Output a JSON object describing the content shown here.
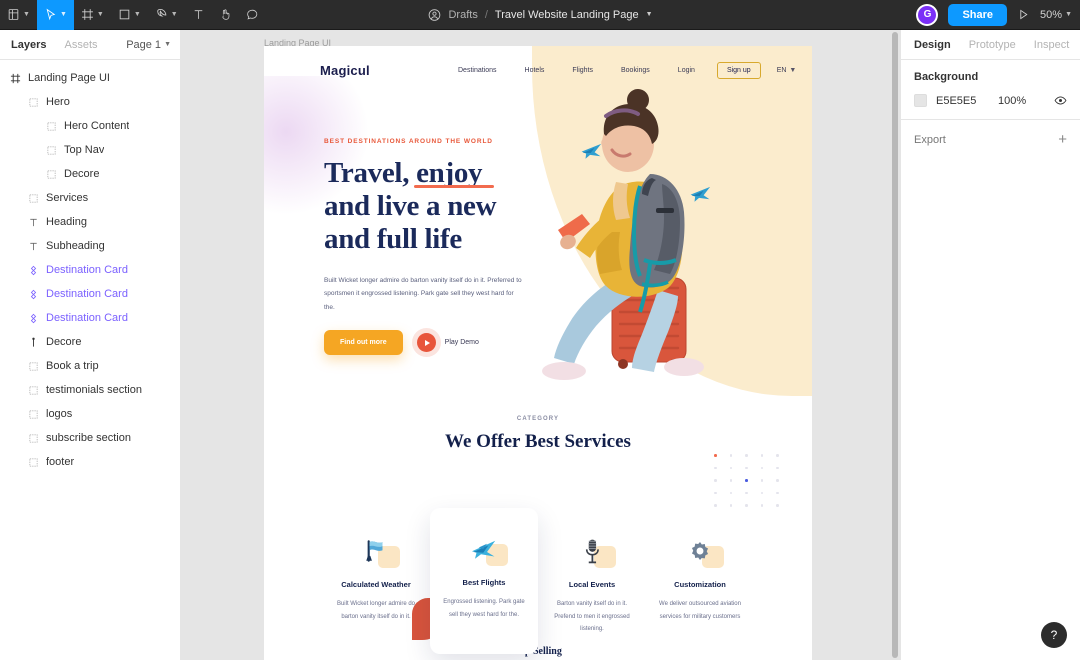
{
  "toolbar": {
    "tools": [
      {
        "name": "figma-menu-icon",
        "caret": true
      },
      {
        "name": "move-tool-icon",
        "caret": true,
        "active": true
      },
      {
        "name": "frame-tool-icon",
        "caret": true
      },
      {
        "name": "shape-tool-icon",
        "caret": true
      },
      {
        "name": "pen-tool-icon",
        "caret": true
      },
      {
        "name": "text-tool-icon",
        "caret": false
      },
      {
        "name": "hand-tool-icon",
        "caret": false
      },
      {
        "name": "comment-tool-icon",
        "caret": false
      }
    ],
    "breadcrumb_parent": "Drafts",
    "breadcrumb_sep": "/",
    "file_name": "Travel Website Landing Page",
    "avatar_initial": "G",
    "share_label": "Share",
    "zoom_level": "50%",
    "accent": "#0d99ff"
  },
  "left_panel": {
    "tabs": [
      {
        "label": "Layers",
        "active": true
      },
      {
        "label": "Assets",
        "active": false
      }
    ],
    "page_selector": "Page 1",
    "layers": [
      {
        "label": "Landing Page UI",
        "icon": "frame-icon",
        "depth": 0,
        "component": false
      },
      {
        "label": "Hero",
        "icon": "group-icon",
        "depth": 1,
        "component": false
      },
      {
        "label": "Hero Content",
        "icon": "group-icon",
        "depth": 2,
        "component": false
      },
      {
        "label": "Top Nav",
        "icon": "group-icon",
        "depth": 2,
        "component": false
      },
      {
        "label": "Decore",
        "icon": "group-icon",
        "depth": 2,
        "component": false
      },
      {
        "label": "Services",
        "icon": "group-icon",
        "depth": 1,
        "component": false
      },
      {
        "label": "Heading",
        "icon": "text-icon",
        "depth": 1,
        "component": false
      },
      {
        "label": "Subheading",
        "icon": "text-icon",
        "depth": 1,
        "component": false
      },
      {
        "label": "Destination Card",
        "icon": "component-icon",
        "depth": 1,
        "component": true
      },
      {
        "label": "Destination Card",
        "icon": "component-icon",
        "depth": 1,
        "component": true
      },
      {
        "label": "Destination Card",
        "icon": "component-icon",
        "depth": 1,
        "component": true
      },
      {
        "label": "Decore",
        "icon": "vector-icon",
        "depth": 1,
        "component": false
      },
      {
        "label": "Book a trip",
        "icon": "group-icon",
        "depth": 1,
        "component": false
      },
      {
        "label": "testimonials section",
        "icon": "group-icon",
        "depth": 1,
        "component": false
      },
      {
        "label": "logos",
        "icon": "group-icon",
        "depth": 1,
        "component": false
      },
      {
        "label": "subscribe section",
        "icon": "group-icon",
        "depth": 1,
        "component": false
      },
      {
        "label": "footer",
        "icon": "group-icon",
        "depth": 1,
        "component": false
      }
    ]
  },
  "canvas": {
    "frame_label": "Landing Page UI",
    "site": {
      "logo": "Magicul",
      "nav_links": [
        "Destinations",
        "Hotels",
        "Flights",
        "Bookings",
        "Login"
      ],
      "signup_label": "Sign up",
      "language": "EN",
      "hero": {
        "eyebrow": "BEST DESTINATIONS AROUND THE WORLD",
        "title_line1_a": "Travel, ",
        "title_line1_b": "enjoy",
        "title_line2": "and live a new",
        "title_line3": "and full life",
        "paragraph": "Built Wicket longer admire do barton vanity itself do in it. Preferred to sportsmen it engrossed listening. Park gate sell they west hard for the.",
        "primary_cta": "Find out more",
        "demo_cta": "Play Demo"
      },
      "services": {
        "category": "CATEGORY",
        "heading": "We Offer Best Services",
        "cards": [
          {
            "title": "Calculated Weather",
            "desc": "Built Wicket longer admire do barton vanity itself do in it.",
            "icon": "weather-flag-icon",
            "raised": false
          },
          {
            "title": "Best Flights",
            "desc": "Engrossed listening. Park gate sell they west hard for the.",
            "icon": "airplane-icon",
            "raised": true
          },
          {
            "title": "Local Events",
            "desc": "Barton vanity itself do in it. Prefend to men it engrossed listening.",
            "icon": "microphone-icon",
            "raised": false
          },
          {
            "title": "Customization",
            "desc": "We deliver outsourced aviation services for military customers",
            "icon": "gear-icon",
            "raised": false
          }
        ]
      },
      "top_selling": "Top Selling"
    }
  },
  "right_panel": {
    "tabs": [
      {
        "label": "Design",
        "active": true
      },
      {
        "label": "Prototype",
        "active": false
      },
      {
        "label": "Inspect",
        "active": false
      }
    ],
    "background": {
      "title": "Background",
      "hex": "E5E5E5",
      "opacity": "100%"
    },
    "export": {
      "title": "Export",
      "add": "+"
    }
  },
  "help": {
    "label": "?"
  }
}
